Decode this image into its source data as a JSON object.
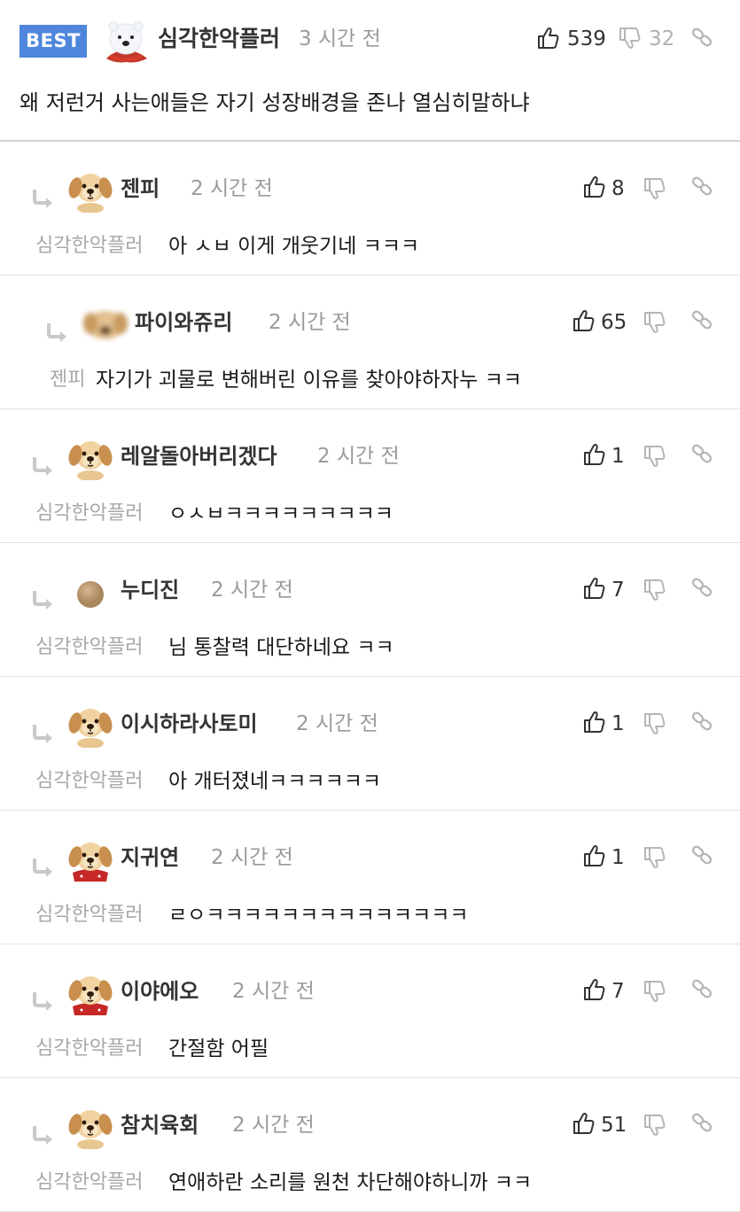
{
  "best_comment": {
    "badge": "BEST",
    "username": "심각한악플러",
    "time": "3 시간 전",
    "likes": "539",
    "dislikes": "32",
    "text": "왜 저런거 사는애들은 자기 성장배경을 존나 열심히말하냐"
  },
  "replies": [
    {
      "username": "젠피",
      "time": "2 시간 전",
      "likes": "8",
      "mention": "심각한악플러",
      "text": "아 ㅅㅂ 이게 개웃기네 ㅋㅋㅋ"
    },
    {
      "username": "파이와쥬리",
      "time": "2 시간 전",
      "likes": "65",
      "mention": "젠피",
      "text": "자기가 괴물로 변해버린 이유를 찾아야하자누 ㅋㅋ"
    },
    {
      "username": "레알돌아버리겠다",
      "time": "2 시간 전",
      "likes": "1",
      "mention": "심각한악플러",
      "text": "ㅇㅅㅂㅋㅋㅋㅋㅋㅋㅋㅋㅋ"
    },
    {
      "username": "누디진",
      "time": "2 시간 전",
      "likes": "7",
      "mention": "심각한악플러",
      "text": "님 통찰력 대단하네요 ㅋㅋ"
    },
    {
      "username": "이시하라사토미",
      "time": "2 시간 전",
      "likes": "1",
      "mention": "심각한악플러",
      "text": "아 개터졌네ㅋㅋㅋㅋㅋㅋ"
    },
    {
      "username": "지귀연",
      "time": "2 시간 전",
      "likes": "1",
      "mention": "심각한악플러",
      "text": "ㄹㅇㅋㅋㅋㅋㅋㅋㅋㅋㅋㅋㅋㅋㅋㅋ"
    },
    {
      "username": "이야에오",
      "time": "2 시간 전",
      "likes": "7",
      "mention": "심각한악플러",
      "text": "간절함 어필"
    },
    {
      "username": "참치육회",
      "time": "2 시간 전",
      "likes": "51",
      "mention": "심각한악플러",
      "text": "연애하란 소리를 원천 차단해야하니까 ㅋㅋ"
    }
  ],
  "icons": {
    "thumbs_up": "thumbs-up-icon",
    "thumbs_down": "thumbs-down-icon",
    "link": "link-icon",
    "reply_arrow": "reply-arrow-icon"
  },
  "colors": {
    "best_badge": "#4f86dc",
    "username": "#333333",
    "meta_gray": "#9a9a9a",
    "mention_gray": "#a8a8a8"
  }
}
